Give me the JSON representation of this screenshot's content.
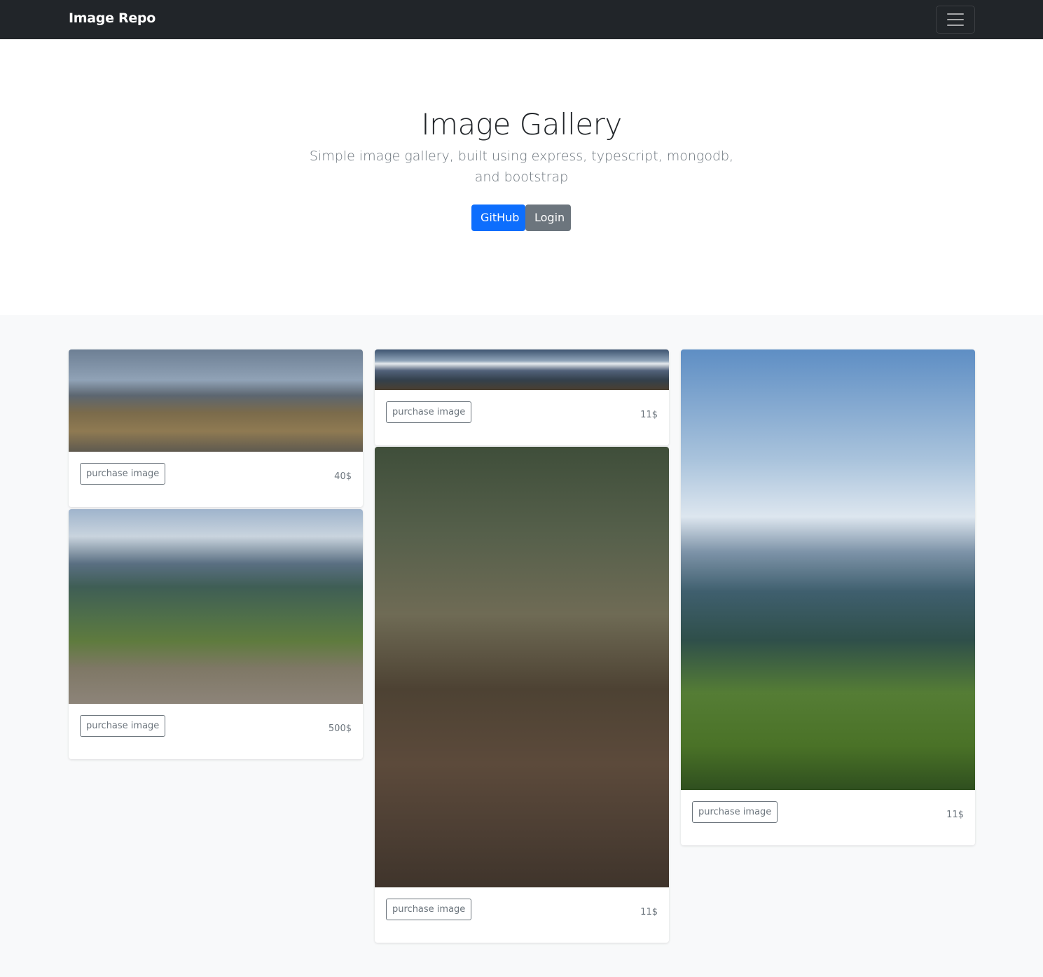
{
  "navbar": {
    "brand": "Image Repo"
  },
  "hero": {
    "title": "Image Gallery",
    "subtitle": "Simple image gallery, built using express, typescript, mongodb, and bootstrap",
    "github_label": "GitHub",
    "login_label": "Login"
  },
  "cards": [
    {
      "purchase_label": "purchase image",
      "price": "40$"
    },
    {
      "purchase_label": "purchase image",
      "price": "500$"
    },
    {
      "purchase_label": "purchase image",
      "price": "11$"
    },
    {
      "purchase_label": "purchase image",
      "price": "11$"
    },
    {
      "purchase_label": "purchase image",
      "price": "11$"
    }
  ]
}
